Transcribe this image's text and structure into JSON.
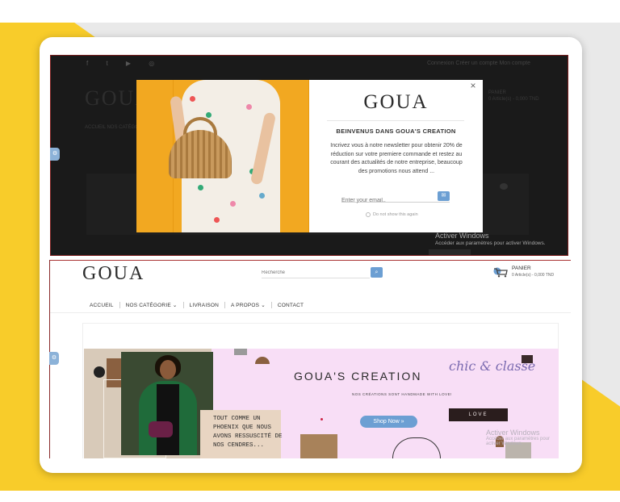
{
  "popup_screen": {
    "social_icons": [
      "facebook-icon",
      "twitter-icon",
      "youtube-icon",
      "instagram-icon"
    ],
    "top_links": "Connexion   Créer un compte   Mon compte",
    "bg_logo": "GOUA",
    "bg_menu": "ACCUEIL   NOS CATÉGORIES",
    "bg_right": [
      "PANIER",
      "0 Article(s) - 0,000 TND"
    ],
    "modal": {
      "close_icon": "×",
      "logo": "GOUA",
      "title": "BEINVENUS DANS GOUA'S CREATION",
      "text": "Incrivez vous à notre newsletter pour obtenir 20% de réduction sur votre premiere commande et restez au courant des actualités de notre entreprise, beaucoup des promotions nous attend ...",
      "email_placeholder": "Enter your email..",
      "send_icon": "✉",
      "no_show_label": "Do not show this again"
    },
    "windows_watermark": [
      "Activer Windows",
      "Accéder aux paramètres pour activer Windows."
    ]
  },
  "site": {
    "logo": "GOUA",
    "search_placeholder": "Recherche",
    "search_icon": "🔍",
    "cart_label": "PANIER",
    "cart_sub": "0 Article(s) - 0,000 TND",
    "nav": [
      "ACCUEIL",
      "NOS CATÉGORIE ⌄",
      "LIVRAISON",
      "A PROPOS ⌄",
      "CONTACT"
    ],
    "banner": {
      "title": "GOUA'S CREATION",
      "subtitle": "NOS CRÉATIONS SONT HANDMADE WITH LOVE!",
      "script_text": "chic & classe",
      "quote": "TOUT COMME UN PHOENIX QUE NOUS AVONS RESSUSCITÉ DE NOS CENDRES...",
      "shop_button": "Shop Now »",
      "love_label": "LOVE"
    },
    "windows_watermark": [
      "Activer Windows",
      "Accéder aux paramètres pour activer Windows."
    ]
  },
  "colors": {
    "accent_blue": "#6c9fd3",
    "yellow": "#f8cc2a",
    "pink": "#f8def6"
  }
}
